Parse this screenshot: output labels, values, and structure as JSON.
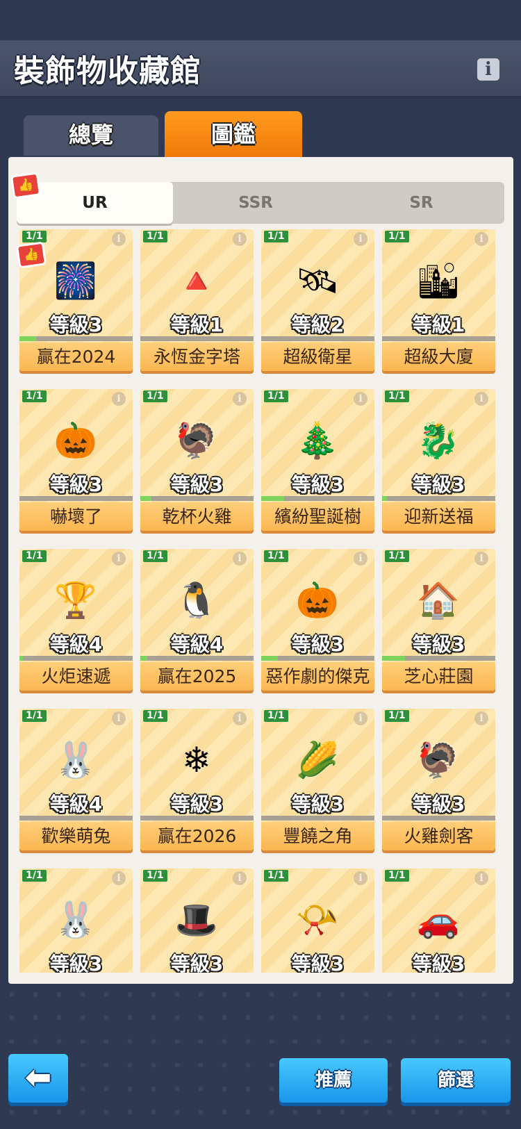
{
  "header": {
    "title": "裝飾物收藏館",
    "info_icon": "info-icon"
  },
  "tabs": [
    {
      "label": "總覽",
      "active": false
    },
    {
      "label": "圖鑑",
      "active": true
    }
  ],
  "rarity_tabs": [
    {
      "label": "UR",
      "active": true
    },
    {
      "label": "SSR",
      "active": false
    },
    {
      "label": "SR",
      "active": false
    }
  ],
  "items": [
    {
      "count": "1/1",
      "level": "等級3",
      "name": "贏在2024",
      "icon": "🎆",
      "progress": 0.15
    },
    {
      "count": "1/1",
      "level": "等級1",
      "name": "永恆金字塔",
      "icon": "🔺",
      "progress": 0.0
    },
    {
      "count": "1/1",
      "level": "等級2",
      "name": "超級衛星",
      "icon": "🛰",
      "progress": 0.0
    },
    {
      "count": "1/1",
      "level": "等級1",
      "name": "超級大廈",
      "icon": "🏙",
      "progress": 0.0
    },
    {
      "count": "1/1",
      "level": "等級3",
      "name": "嚇壞了",
      "icon": "🎃",
      "progress": 0.0
    },
    {
      "count": "1/1",
      "level": "等級3",
      "name": "乾杯火雞",
      "icon": "🦃",
      "progress": 0.1
    },
    {
      "count": "1/1",
      "level": "等級3",
      "name": "繽紛聖誕樹",
      "icon": "🎄",
      "progress": 0.2
    },
    {
      "count": "1/1",
      "level": "等級3",
      "name": "迎新送福",
      "icon": "🐉",
      "progress": 0.04
    },
    {
      "count": "1/1",
      "level": "等級4",
      "name": "火炬速遞",
      "icon": "🏆",
      "progress": 0.03
    },
    {
      "count": "1/1",
      "level": "等級4",
      "name": "贏在2025",
      "icon": "🐧",
      "progress": 0.06
    },
    {
      "count": "1/1",
      "level": "等級3",
      "name": "惡作劇的傑克",
      "icon": "🎃",
      "progress": 0.15
    },
    {
      "count": "1/1",
      "level": "等級3",
      "name": "芝心莊園",
      "icon": "🏠",
      "progress": 0.2
    },
    {
      "count": "1/1",
      "level": "等級4",
      "name": "歡樂萌兔",
      "icon": "🐰",
      "progress": 0.0
    },
    {
      "count": "1/1",
      "level": "等級3",
      "name": "贏在2026",
      "icon": "❄",
      "progress": 0.0
    },
    {
      "count": "1/1",
      "level": "等級3",
      "name": "豐饒之角",
      "icon": "🌽",
      "progress": 0.0
    },
    {
      "count": "1/1",
      "level": "等級3",
      "name": "火雞劍客",
      "icon": "🦃",
      "progress": 0.0
    },
    {
      "count": "1/1",
      "level": "等級3",
      "name": "",
      "icon": "🐰",
      "progress": 0.0
    },
    {
      "count": "1/1",
      "level": "等級3",
      "name": "",
      "icon": "🎩",
      "progress": 0.0
    },
    {
      "count": "1/1",
      "level": "等級3",
      "name": "",
      "icon": "📯",
      "progress": 0.0
    },
    {
      "count": "1/1",
      "level": "等級3",
      "name": "",
      "icon": "🚗",
      "progress": 0.0
    }
  ],
  "footer": {
    "back_icon": "back-arrow-icon",
    "recommend_label": "推薦",
    "filter_label": "篩選"
  }
}
